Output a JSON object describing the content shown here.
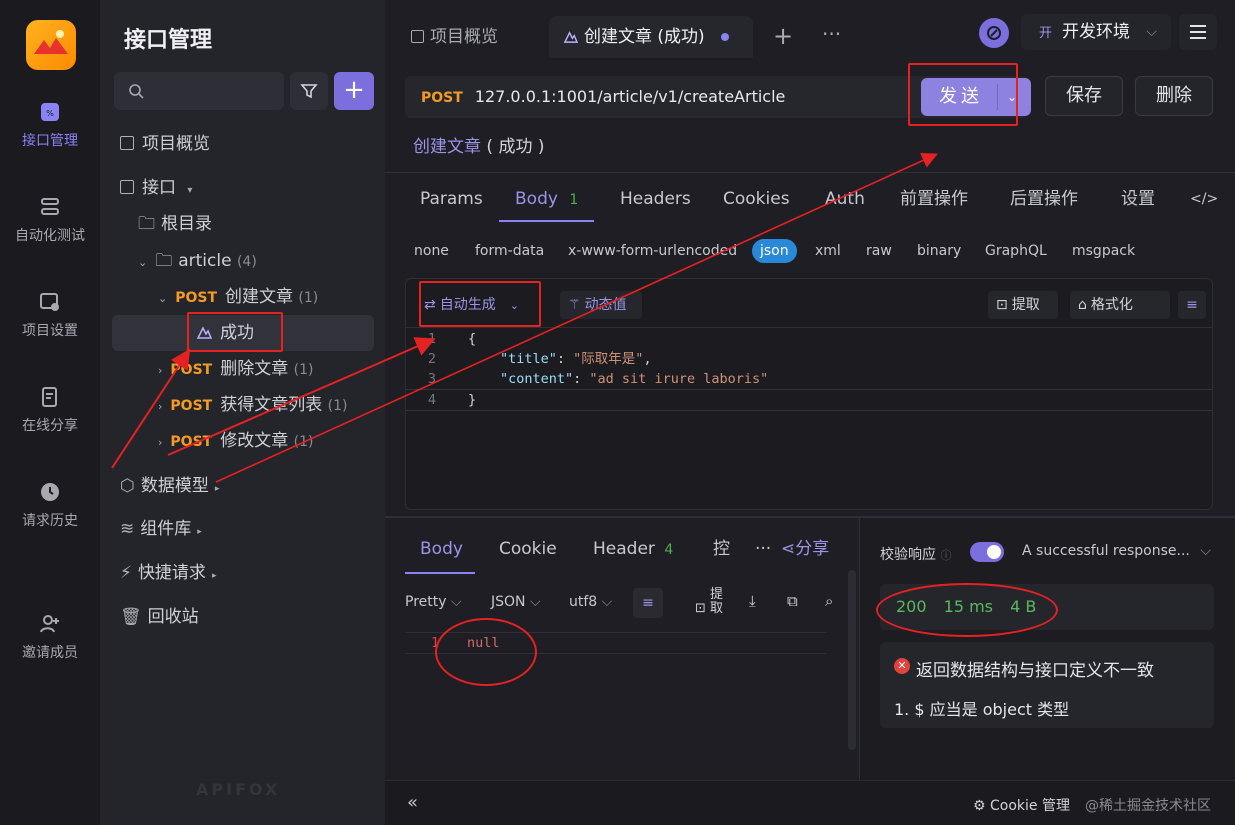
{
  "sidebar": {
    "title": "接口管理",
    "rail": [
      {
        "label": "接口管理",
        "icon": "api-icon"
      },
      {
        "label": "自动化测试",
        "icon": "automation-icon"
      },
      {
        "label": "项目设置",
        "icon": "project-settings-icon"
      },
      {
        "label": "在线分享",
        "icon": "share-doc-icon"
      },
      {
        "label": "请求历史",
        "icon": "history-icon"
      },
      {
        "label": "邀请成员",
        "icon": "invite-user-icon"
      }
    ],
    "tree": {
      "overview": "项目概览",
      "api": "接口",
      "root": "根目录",
      "folder": "article",
      "folder_count": "(4)",
      "method": "POST",
      "items": [
        {
          "name": "创建文章",
          "count": "(1)"
        },
        {
          "name": "删除文章",
          "count": "(1)"
        },
        {
          "name": "获得文章列表",
          "count": "(1)"
        },
        {
          "name": "修改文章",
          "count": "(1)"
        }
      ],
      "case": "成功",
      "data_model": "数据模型",
      "components": "组件库",
      "quick_request": "快捷请求",
      "recycle": "回收站"
    },
    "watermark": "APIFOX"
  },
  "tabs": {
    "overview": "项目概览",
    "active": "创建文章 (成功)",
    "env": "开发环境",
    "env_badge": "开"
  },
  "request": {
    "method": "POST",
    "url": "127.0.0.1:1001/article/v1/createArticle",
    "send": "发送",
    "save": "保存",
    "delete": "删除",
    "name_link": "创建文章",
    "name_suffix": "( 成功 )"
  },
  "subtabs": {
    "params": "Params",
    "body": "Body",
    "body_count": "1",
    "headers": "Headers",
    "cookies": "Cookies",
    "auth": "Auth",
    "pre": "前置操作",
    "post": "后置操作",
    "settings": "设置"
  },
  "body_types": [
    "none",
    "form-data",
    "x-www-form-urlencoded",
    "json",
    "xml",
    "raw",
    "binary",
    "GraphQL",
    "msgpack"
  ],
  "editor_toolbar": {
    "auto_gen": "自动生成",
    "dynamic": "动态值",
    "extract": "提取",
    "format": "格式化"
  },
  "code": {
    "line_numbers": [
      "1",
      "2",
      "3",
      "4"
    ],
    "l1": "{",
    "k1": "\"title\"",
    "v1": "\"际取年是\"",
    "k2": "\"content\"",
    "v2": "\"ad sit irure laboris\"",
    "l4": "}"
  },
  "response": {
    "tabs": {
      "body": "Body",
      "cookie": "Cookie",
      "header": "Header",
      "header_count": "4",
      "console": "控",
      "share": "分享"
    },
    "toolbar": {
      "pretty": "Pretty",
      "json": "JSON",
      "utf8": "utf8",
      "extract": "提取"
    },
    "line": "1",
    "content": "null",
    "validate_label": "校验响应",
    "validate_select": "A successful response...",
    "status": "200",
    "time": "15 ms",
    "size": "4 B",
    "error": "返回数据结构与接口定义不一致",
    "error_detail": "1. $ 应当是 object 类型"
  },
  "footer": {
    "cookie_mgr": "Cookie 管理",
    "watermark": "@稀土掘金技术社区"
  },
  "colors": {
    "accent": "#8b82f6",
    "post": "#f39b23",
    "annotation": "#e52222",
    "success": "#5cb85c"
  }
}
